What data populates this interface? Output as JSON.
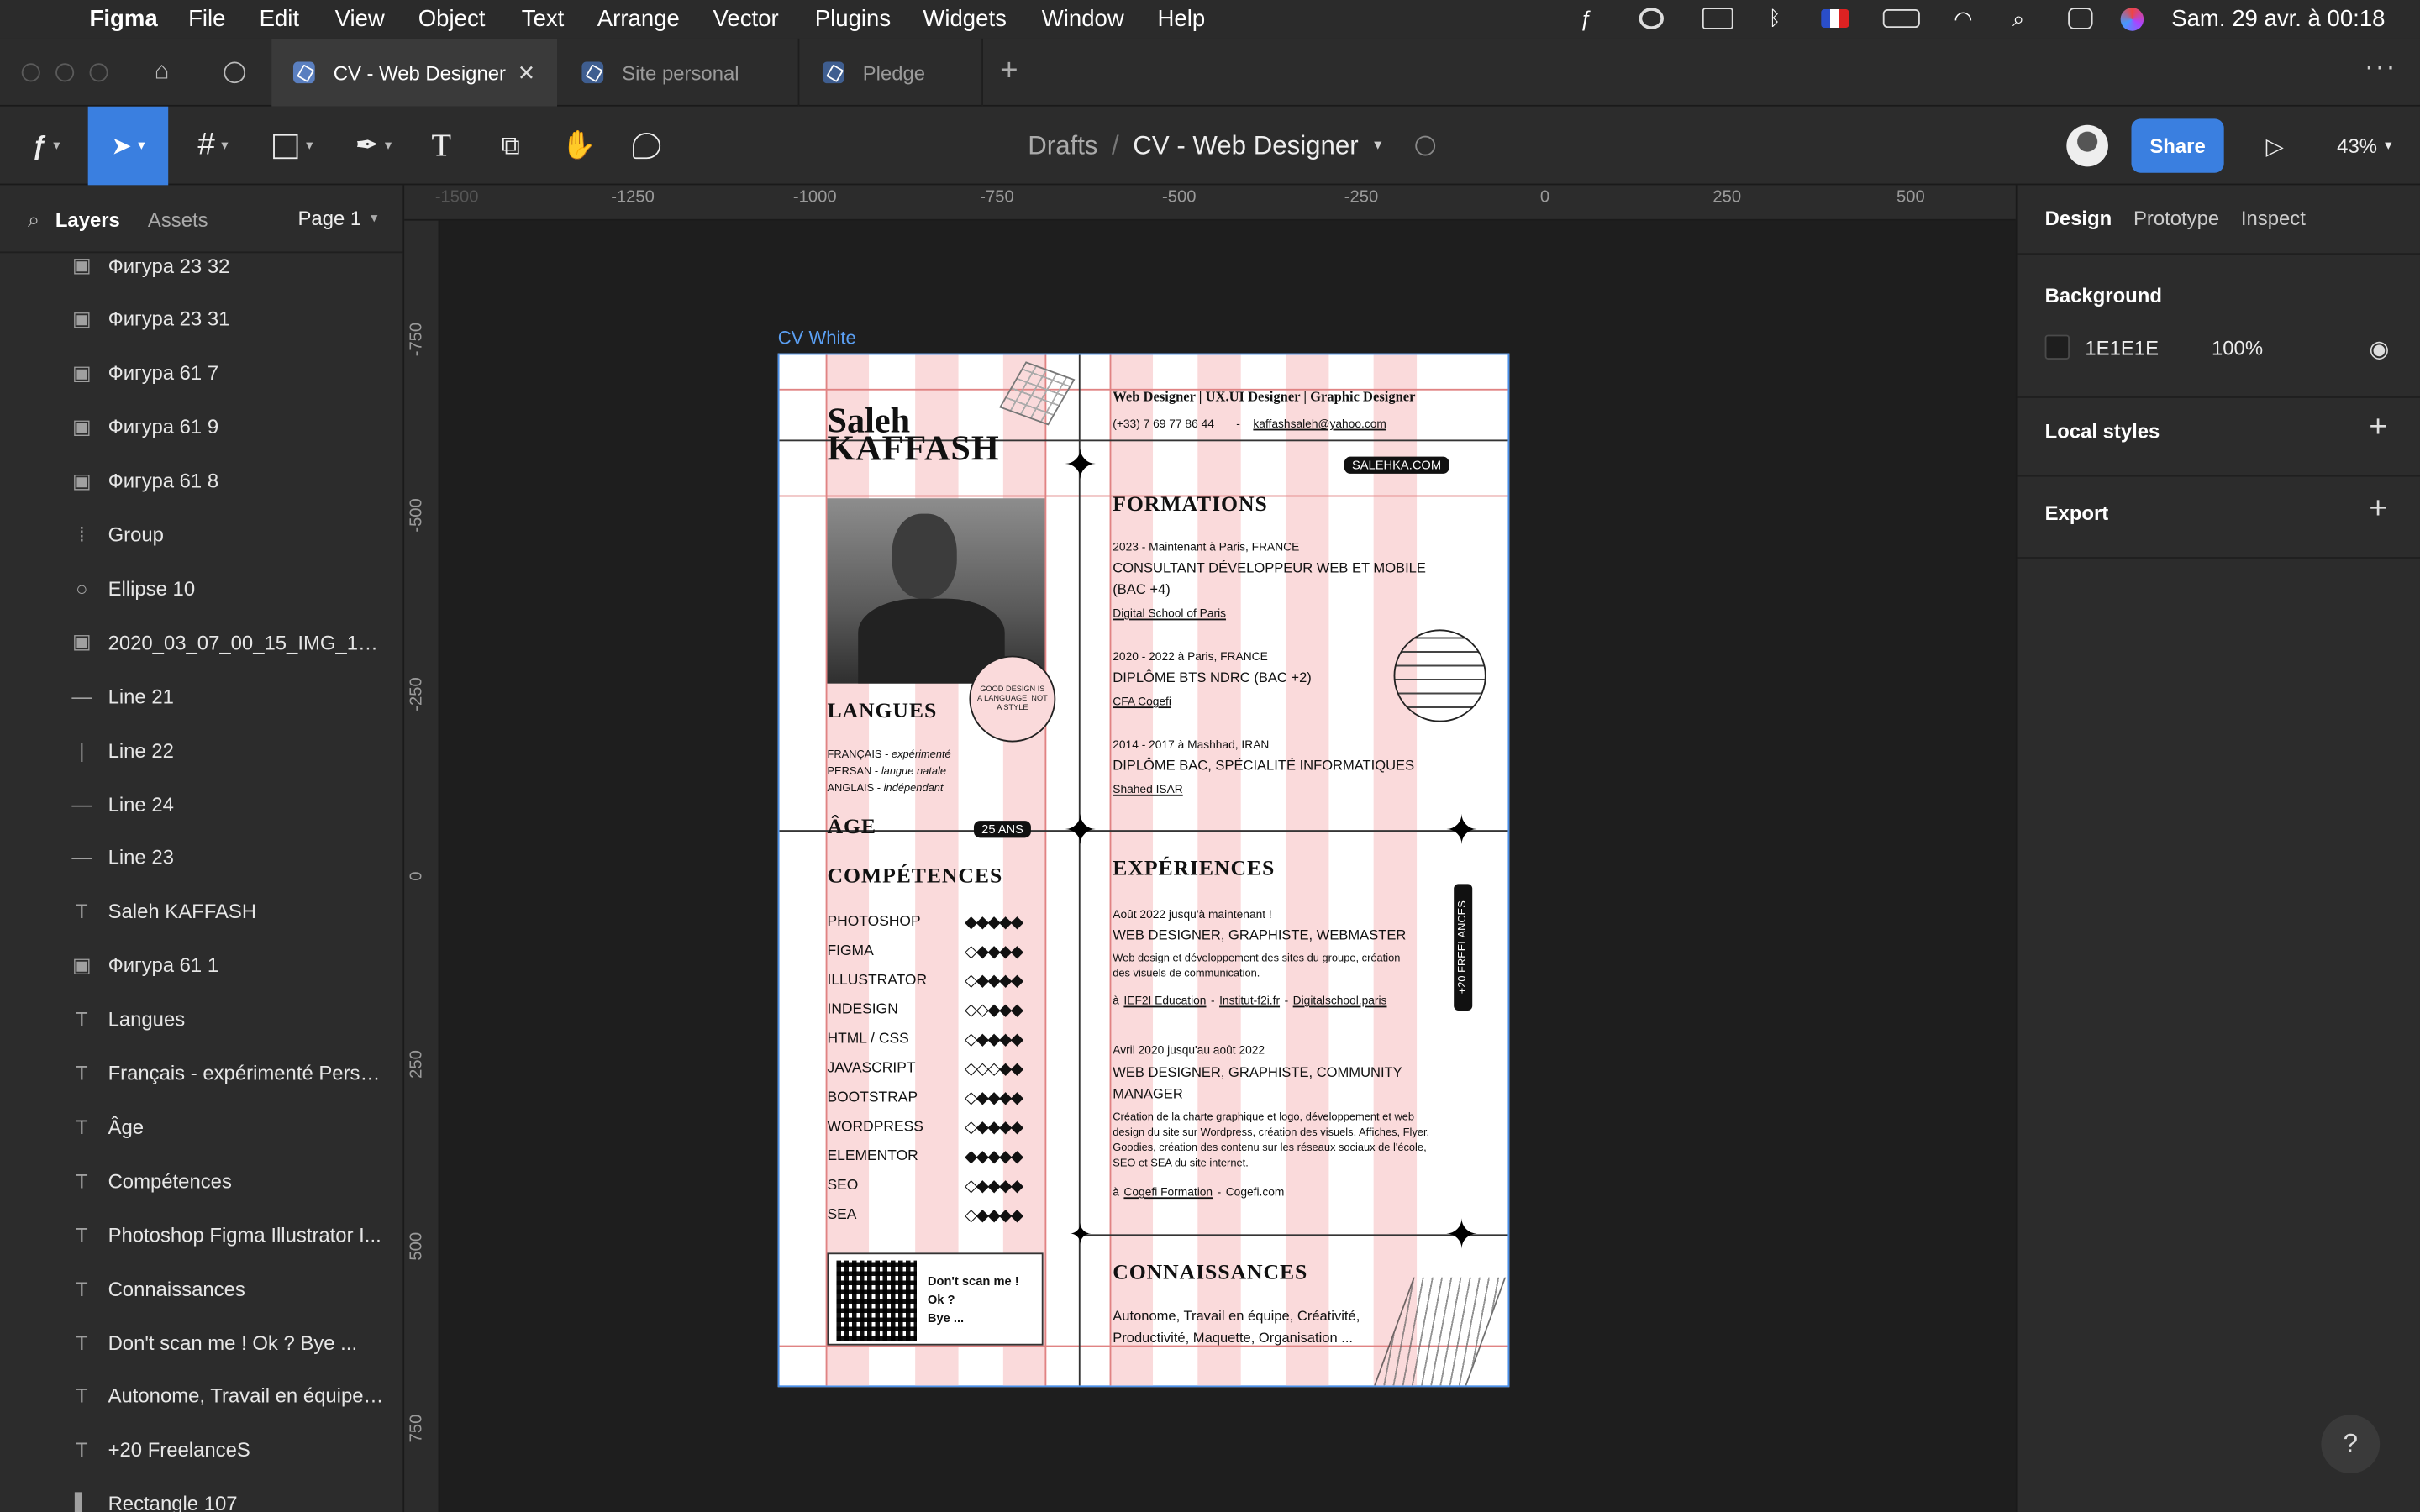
{
  "menubar": {
    "app": "Figma",
    "items": [
      "File",
      "Edit",
      "View",
      "Object",
      "Text",
      "Arrange",
      "Vector",
      "Plugins",
      "Widgets",
      "Window",
      "Help"
    ],
    "datetime": "Sam. 29 avr. à  00:18"
  },
  "tabs": [
    {
      "label": "CV - Web Designer",
      "active": true
    },
    {
      "label": "Site personal",
      "active": false
    },
    {
      "label": "Pledge",
      "active": false
    }
  ],
  "toolbar": {
    "breadcrumb_parent": "Drafts",
    "breadcrumb_sep": "/",
    "file_name": "CV - Web Designer",
    "share_label": "Share",
    "zoom": "43%"
  },
  "left_panel": {
    "tab_layers": "Layers",
    "tab_assets": "Assets",
    "page": "Page 1",
    "layers": [
      {
        "icon": "image",
        "name": "Фигура 23 32"
      },
      {
        "icon": "image",
        "name": "Фигура 23 31"
      },
      {
        "icon": "image",
        "name": "Фигура 61 7"
      },
      {
        "icon": "image",
        "name": "Фигура 61 9"
      },
      {
        "icon": "image",
        "name": "Фигура 61 8"
      },
      {
        "icon": "group",
        "name": "Group"
      },
      {
        "icon": "ellipse",
        "name": "Ellipse 10"
      },
      {
        "icon": "image",
        "name": "2020_03_07_00_15_IMG_1824 1"
      },
      {
        "icon": "hline",
        "name": "Line 21"
      },
      {
        "icon": "vline",
        "name": "Line 22"
      },
      {
        "icon": "hline",
        "name": "Line 24"
      },
      {
        "icon": "hline",
        "name": "Line 23"
      },
      {
        "icon": "text",
        "name": "Saleh KAFFASH"
      },
      {
        "icon": "image",
        "name": "Фигура 61 1"
      },
      {
        "icon": "text",
        "name": "Langues"
      },
      {
        "icon": "text",
        "name": "Français - expérimenté Persa..."
      },
      {
        "icon": "text",
        "name": "Âge"
      },
      {
        "icon": "text",
        "name": "Compétences"
      },
      {
        "icon": "text",
        "name": "Photoshop Figma Illustrator I..."
      },
      {
        "icon": "text",
        "name": "Connaissances"
      },
      {
        "icon": "text",
        "name": "Don't scan me ! Ok ? Bye ..."
      },
      {
        "icon": "text",
        "name": "Autonome, Travail en équipe, ..."
      },
      {
        "icon": "text",
        "name": "+20 FreelanceS"
      },
      {
        "icon": "rect",
        "name": "Rectangle 107"
      }
    ]
  },
  "right_panel": {
    "tab_design": "Design",
    "tab_prototype": "Prototype",
    "tab_inspect": "Inspect",
    "background_label": "Background",
    "bg_hex": "1E1E1E",
    "bg_color": "#1e1e1e",
    "bg_opacity": "100%",
    "local_styles": "Local styles",
    "export": "Export",
    "help": "?"
  },
  "rulers": {
    "h": [
      "-1500",
      "-1250",
      "-1000",
      "-750",
      "-500",
      "-250",
      "0",
      "250",
      "500"
    ],
    "v": [
      "-750",
      "-500",
      "-250",
      "0",
      "250",
      "500",
      "750"
    ]
  },
  "frame_label": "CV White",
  "cv": {
    "name_first": "Saleh",
    "name_last": "KAFFASH",
    "roles": "Web Designer  |  UX.UI Designer  |  Graphic Designer",
    "phone": "(+33) 7 69 77 86 44",
    "dash": "-",
    "email": "kaffashsaleh@yahoo.com",
    "website": "SALEHKA.COM",
    "langues_title": "LANGUES",
    "langues": [
      {
        "lang": "FRANÇAIS",
        "level": "expérimenté"
      },
      {
        "lang": "PERSAN",
        "level": "langue natale"
      },
      {
        "lang": "ANGLAIS",
        "level": "indépendant"
      }
    ],
    "age_title": "ÂGE",
    "age": "25 ANS",
    "competences_title": "COMPÉTENCES",
    "skills": [
      {
        "name": "PHOTOSHOP",
        "level": 5
      },
      {
        "name": "FIGMA",
        "level": 4
      },
      {
        "name": "ILLUSTRATOR",
        "level": 4
      },
      {
        "name": "INDESIGN",
        "level": 3
      },
      {
        "name": "HTML / CSS",
        "level": 4
      },
      {
        "name": "JAVASCRIPT",
        "level": 2
      },
      {
        "name": "BOOTSTRAP",
        "level": 4
      },
      {
        "name": "WORDPRESS",
        "level": 4
      },
      {
        "name": "ELEMENTOR",
        "level": 5
      },
      {
        "name": "SEO",
        "level": 4
      },
      {
        "name": "SEA",
        "level": 4
      }
    ],
    "qr_text": [
      "Don't scan me !",
      "Ok ?",
      "Bye ..."
    ],
    "stamp_text": "GOOD DESIGN IS A LANGUAGE, NOT A STYLE",
    "formations_title": "FORMATIONS",
    "formations": [
      {
        "when": "2023 - Maintenant à Paris, FRANCE",
        "title": "CONSULTANT DÉVELOPPEUR WEB ET MOBILE",
        "title2": "(BAC +4)",
        "school": "Digital School of Paris"
      },
      {
        "when": "2020 - 2022 à Paris, FRANCE",
        "title": "DIPLÔME BTS NDRC (BAC +2)",
        "title2": "",
        "school": "CFA Cogefi"
      },
      {
        "when": "2014 - 2017 à Mashhad, IRAN",
        "title": "DIPLÔME BAC, SPÉCIALITÉ INFORMATIQUES",
        "title2": "",
        "school": "Shahed ISAR"
      }
    ],
    "experiences_title": "EXPÉRIENCES",
    "freelances": "+20 FREELANCES",
    "exp1": {
      "when": "Août 2022 jusqu'à maintenant !",
      "title": "WEB DESIGNER, GRAPHISTE, WEBMASTER",
      "desc1": "Web design et développement des sites du groupe, création",
      "desc2": "des visuels de communication.",
      "at": "à",
      "l1": "IEF2I Education",
      "l2": "Institut-f2i.fr",
      "l3": "Digitalschool.paris",
      "sep": "-"
    },
    "exp2": {
      "when": "Avril 2020 jusqu'au août 2022",
      "title1": "WEB DESIGNER, GRAPHISTE, COMMUNITY",
      "title2": "MANAGER",
      "desc1": "Création de la charte graphique et logo, développement et web",
      "desc2": "design du site sur Wordpress, création des visuels, Affiches, Flyer,",
      "desc3": "Goodies, création des contenu sur les réseaux sociaux de l'école,",
      "desc4": "SEO et SEA du site internet.",
      "at": "à",
      "l1": "Cogefi Formation",
      "l2": "Cogefi.com",
      "sep": "-"
    },
    "connaissances_title": "CONNAISSANCES",
    "connaissances1": "Autonome, Travail en équipe, Créativité,",
    "connaissances2": "Productivité, Maquette, Organisation ..."
  }
}
